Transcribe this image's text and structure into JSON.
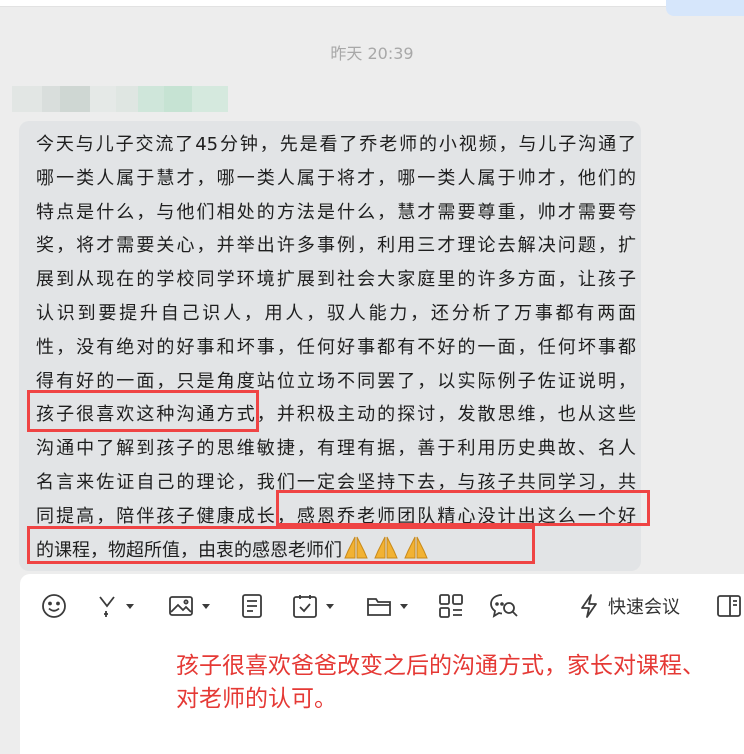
{
  "chat": {
    "timestamp": "昨天 20:39",
    "message_lines": [
      "今天与儿子交流了45分钟，先是看了乔老师的小视频，与儿子沟通了",
      "哪一类人属于慧才，哪一类人属于将才，哪一类人属于帅才，他们的",
      "特点是什么，与他们相处的方法是什么，慧才需要尊重，帅才需要夸",
      "奖，将才需要关心，并举出许多事例，利用三才理论去解决问题，扩",
      "展到从现在的学校同学环境扩展到社会大家庭里的许多方面，让孩子",
      "认识到要提升自己识人，用人，驭人能力，还分析了万事都有两面",
      "性，没有绝对的好事和坏事，任何好事都有不好的一面，任何坏事都",
      "得有好的一面，只是角度站位立场不同罢了，以实际例子佐证说明，",
      "孩子很喜欢这种沟通方式，并积极主动的探讨，发散思维，也从这些",
      "沟通中了解到孩子的思维敏捷，有理有据，善于利用历史典故、名人",
      "名言来佐证自己的理论，我们一定会坚持下去，与孩子共同学习，共",
      "同提高，陪伴孩子健康成长，感恩乔老师团队精心没计出这么一个好",
      "的课程，物超所值，由衷的感恩老师们"
    ],
    "emoji_icons": [
      "folded-hands-icon",
      "folded-hands-icon",
      "folded-hands-icon"
    ]
  },
  "toolbar": {
    "icons": [
      "emoji-icon",
      "scissors-icon",
      "image-icon",
      "document-icon",
      "task-icon",
      "folder-icon",
      "apps-icon",
      "chat-search-icon",
      "lightning-icon",
      "sidebar-icon"
    ],
    "quick_meeting_label": "快速会议"
  },
  "annotation": {
    "text": "孩子很喜欢爸爸改变之后的沟通方式，家长对课程、对老师的认可。"
  },
  "colors": {
    "background": "#ededed",
    "bubble": "#e2e4e6",
    "highlight_border": "#ef4444",
    "annotation_text": "#e53935",
    "emoji_fill": "#f2b233"
  }
}
